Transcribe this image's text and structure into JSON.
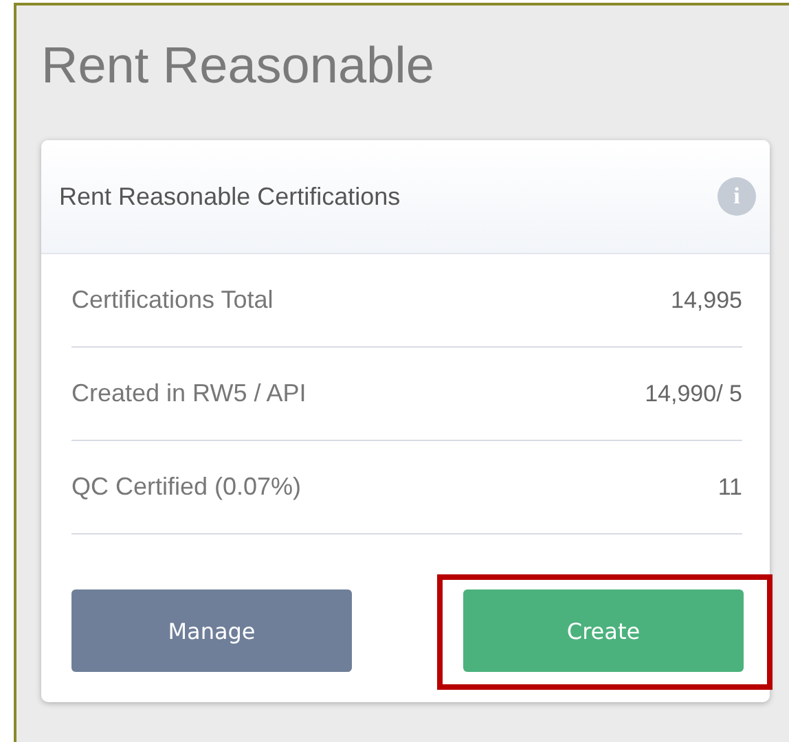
{
  "page": {
    "title": "Rent Reasonable"
  },
  "card": {
    "title": "Rent Reasonable Certifications",
    "info_icon": "i",
    "rows": [
      {
        "label": "Certifications Total",
        "value": "14,995"
      },
      {
        "label": "Created in RW5 / API",
        "value": "14,990/ 5"
      },
      {
        "label": "QC Certified (0.07%)",
        "value": "11"
      }
    ],
    "buttons": [
      {
        "label": "Manage",
        "kind": "secondary",
        "highlighted": false
      },
      {
        "label": "Create",
        "kind": "primary",
        "highlighted": true
      }
    ]
  }
}
